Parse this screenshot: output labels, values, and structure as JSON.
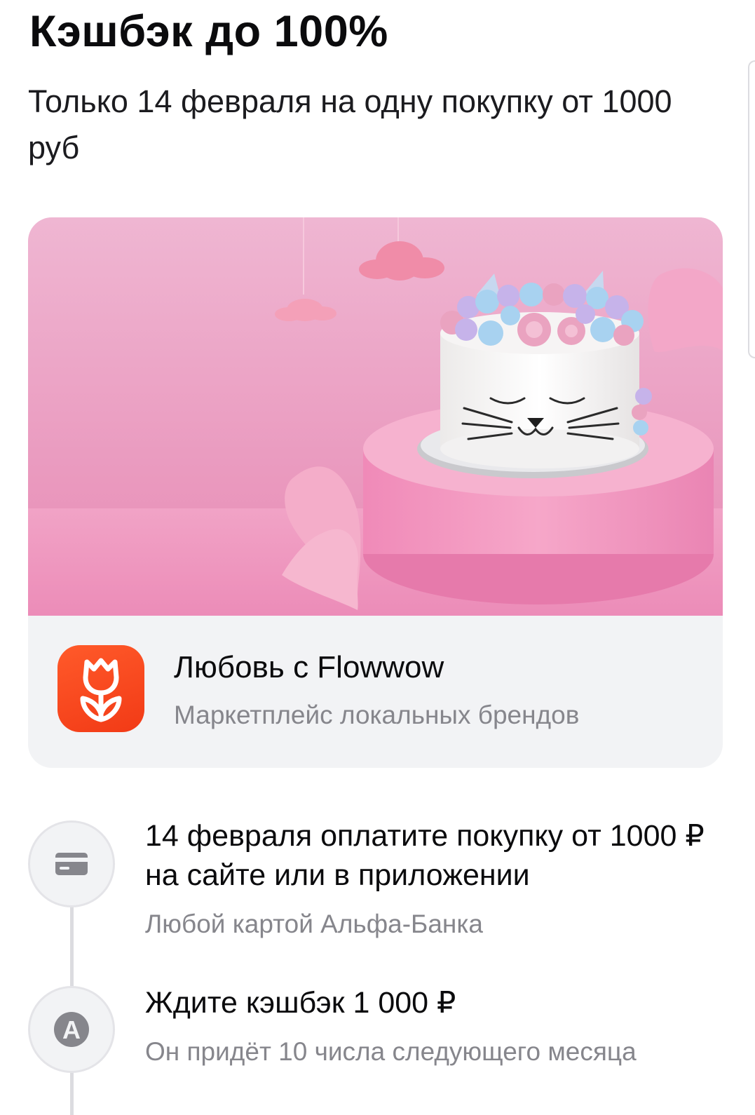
{
  "header": {
    "title": "Кэшбэк до 100%",
    "subtitle": "Только 14 февраля на одну покупку от 1000 руб"
  },
  "promo": {
    "banner_icon": "cat-cake-illustration",
    "merchant_icon": "tulip-icon",
    "merchant_name": "Любовь с Flowwow",
    "merchant_description": "Маркетплейс локальных брендов"
  },
  "steps": [
    {
      "icon": "card-icon",
      "title": "14 февраля оплатите покупку от 1000 ₽ на сайте или в приложении",
      "description": "Любой картой Альфа-Банка"
    },
    {
      "icon": "alfa-letter-icon",
      "icon_letter": "А",
      "title": "Ждите кэшбэк 1 000 ₽",
      "description": "Он придёт 10 числа следующего месяца"
    }
  ],
  "colors": {
    "banner_pink": "#ec97bd",
    "app_icon_orange": "#f23a16",
    "secondary_text": "#86868c",
    "card_background": "#f2f3f5"
  }
}
